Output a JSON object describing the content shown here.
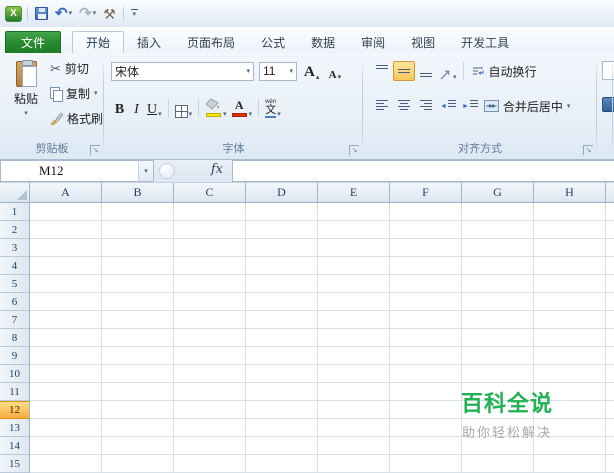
{
  "qat": {
    "excel_logo_letter": "X",
    "save": "save-workbook",
    "undo": "undo",
    "redo": "redo",
    "customize_tools": "customize-tools",
    "more": "customize-quick-access-toolbar"
  },
  "icons": {
    "dropdown_caret": "▾",
    "undo_glyph": "↶",
    "redo_glyph": "↷",
    "tools_glyph": "⚒",
    "scissors_glyph": "✂",
    "launcher_glyph": "↘",
    "grow_caret": "▴",
    "shrink_caret": "▾",
    "left_tri": "◄",
    "right_tri": "►"
  },
  "tabs": {
    "file": "文件",
    "items": [
      "开始",
      "插入",
      "页面布局",
      "公式",
      "数据",
      "审阅",
      "视图",
      "开发工具"
    ],
    "active": "开始"
  },
  "ribbon": {
    "clipboard": {
      "group_label": "剪贴板",
      "paste": "粘贴",
      "cut": "剪切",
      "copy": "复制",
      "format_painter": "格式刷"
    },
    "font": {
      "group_label": "字体",
      "font_name": "宋体",
      "font_size": "11",
      "bold": "B",
      "italic": "I",
      "underline": "U",
      "grow_letter": "A",
      "shrink_letter": "A",
      "font_color_letter": "A",
      "phonetic_pinyin": "wén",
      "phonetic_char": "文"
    },
    "alignment": {
      "group_label": "对齐方式",
      "wrap_text": "自动换行",
      "merge_center": "合并后居中"
    }
  },
  "formula_bar": {
    "name_box": "M12",
    "fx_label": "fx",
    "formula_value": ""
  },
  "grid": {
    "columns": [
      "A",
      "B",
      "C",
      "D",
      "E",
      "F",
      "G",
      "H"
    ],
    "rows": [
      "1",
      "2",
      "3",
      "4",
      "5",
      "6",
      "7",
      "8",
      "9",
      "10",
      "11",
      "12",
      "13",
      "14",
      "15"
    ],
    "highlighted_row": "12",
    "active_cell": "M12"
  },
  "watermark": {
    "title": "百科全说",
    "subtitle": "助你轻松解决",
    "title_color": "#21b254"
  },
  "colors": {
    "file_tab_green": "#2c8c33",
    "selection_highlight": "#fbc75d",
    "row_highlight_orange": "#f8ab3a",
    "watermark_green": "#21b254"
  }
}
